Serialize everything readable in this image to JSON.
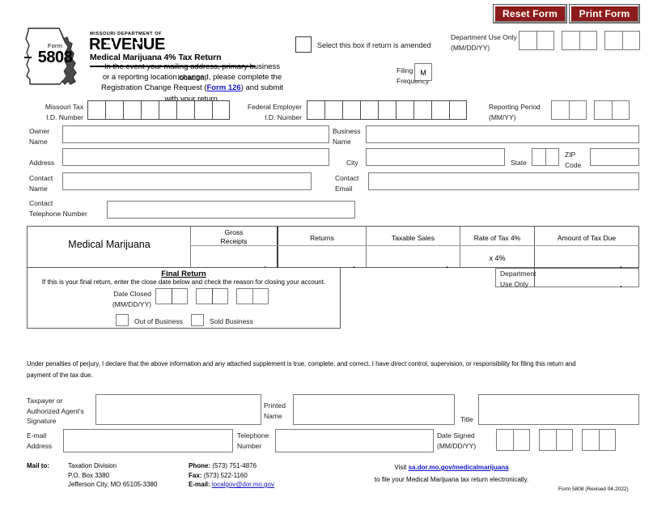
{
  "header": {
    "reset_button": "Reset Form",
    "print_button": "Print Form",
    "form_word": "Form",
    "form_number": "5808",
    "agency_small": "MISSOURI DEPARTMENT OF",
    "agency_big": "REVENUE",
    "form_title": "Medical Marijuana 4% Tax Return",
    "notice_line1": "In the event your mailing address, primary business location,",
    "notice_line2": "or a reporting location changed, please complete the",
    "notice_line3_pre": "Registration Change Request (",
    "notice_link": "Form 126",
    "notice_line3_post": ") and submit with your return.",
    "amended_label": "Select this box if return is amended",
    "filing_frequency_label_1": "Filing",
    "filing_frequency_label_2": "Frequency",
    "filing_frequency_value": "M",
    "dept_use_label_1": "Department Use Only",
    "dept_use_label_2": "(MM/DD/YY)"
  },
  "identity": {
    "mo_tax_id_label_1": "Missouri Tax",
    "mo_tax_id_label_2": "I.D. Number",
    "mo_tax_id_boxes": 8,
    "fein_label_1": "Federal Employer",
    "fein_label_2": "I.D. Number",
    "fein_boxes": 9,
    "reporting_period_label_1": "Reporting Period",
    "reporting_period_label_2": "(MM/YY)",
    "owner_name_label_1": "Owner",
    "owner_name_label_2": "Name",
    "owner_name_value": "",
    "business_name_label_1": "Business",
    "business_name_label_2": "Name",
    "business_name_value": "",
    "address_label": "Address",
    "address_value": "",
    "city_label": "City",
    "city_value": "",
    "state_label": "State",
    "zip_label_1": "ZIP",
    "zip_label_2": "Code",
    "zip_value": "",
    "contact_name_label_1": "Contact",
    "contact_name_label_2": "Name",
    "contact_name_value": "",
    "contact_email_label_1": "Contact",
    "contact_email_label_2": "Email",
    "contact_email_value": "",
    "contact_phone_label_1": "Contact",
    "contact_phone_label_2": "Telephone Number",
    "contact_phone_value": ""
  },
  "tax_table": {
    "row_label": "Medical Marijuana",
    "columns": [
      {
        "line1": "Gross",
        "line2": "Receipts"
      },
      {
        "line1": "Returns",
        "line2": ""
      },
      {
        "line1": "Taxable Sales",
        "line2": ""
      },
      {
        "line1": "Rate of Tax 4%",
        "line2": ""
      },
      {
        "line1": "Amount of Tax Due",
        "line2": ""
      }
    ],
    "gross_receipts_value": "",
    "returns_value": "",
    "taxable_sales_value": "",
    "rate_value": "x  4%",
    "tax_due_value": "",
    "dept_use_only_1": "Department",
    "dept_use_only_2": "Use Only",
    "dept_use_amount_value": ""
  },
  "final_return": {
    "title": "Final Return",
    "subtitle": "If this is your final return, enter the close date below and check the reason for closing your account.",
    "date_closed_label_1": "Date Closed",
    "date_closed_label_2": "(MM/DD/YY)",
    "out_of_business": "Out of Business",
    "sold_business": "Sold Business"
  },
  "signature": {
    "perjury_line1": "Under penalties of perjury, I declare that the above information and any attached supplement is true, complete, and correct.  I have direct control, supervision, or responsibility for filing this return and",
    "perjury_line2": "payment of the tax due.",
    "signature_label_1": "Taxpayer or",
    "signature_label_2": "Authorized Agent’s",
    "signature_label_3": "Signature",
    "signature_value": "",
    "printed_name_label_1": "Printed",
    "printed_name_label_2": "Name",
    "printed_name_value": "",
    "title_label": "Title",
    "title_value": "",
    "email_label_1": "E-mail",
    "email_label_2": "Address",
    "email_value": "",
    "telephone_label_1": "Telephone",
    "telephone_label_2": "Number",
    "telephone_value": "",
    "date_signed_label_1": "Date Signed",
    "date_signed_label_2": "(MM/DD/YY)"
  },
  "footer": {
    "mail_to_label": "Mail to:",
    "address_line1": "Taxation Division",
    "address_line2": "P.O. Box 3380",
    "address_line3": "Jefferson City, MO 65105-3380",
    "phone_label": "Phone:",
    "phone_value": "(573) 751-4876",
    "fax_label": "Fax:",
    "fax_value": "(573) 522-1160",
    "email_label": "E-mail:",
    "email_value": "localgov@dor.mo.gov",
    "visit_pre": "Visit ",
    "visit_link": "sa.dor.mo.gov/medicalmarijuana",
    "visit_post": "to file your Medical Marijuana tax return electronically.",
    "revision": "Form 5808 (Revised 04-2022)"
  },
  "colors": {
    "button_red": "#8e1b1b",
    "link_blue": "#1414c8",
    "border_gray": "#7a7a7a"
  }
}
